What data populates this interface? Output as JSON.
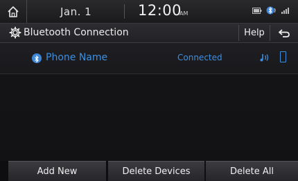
{
  "status_bar": {
    "date": "Jan. 1",
    "time": "12:00",
    "ampm": "AM",
    "icons": [
      "home-icon",
      "battery-icon",
      "bluetooth-status-icon",
      "signal-icon"
    ]
  },
  "title_bar": {
    "title": "Bluetooth Connection",
    "help_label": "Help",
    "icons": [
      "gear-icon",
      "back-icon"
    ]
  },
  "devices": [
    {
      "name": "Phone Name",
      "status": "Connected",
      "icons": [
        "bluetooth-icon",
        "audio-streaming-icon",
        "phone-icon"
      ]
    }
  ],
  "bottom_buttons": {
    "add_new": "Add New",
    "delete_devices": "Delete Devices",
    "delete_all": "Delete All"
  },
  "colors": {
    "accent": "#3d8fe0",
    "text": "#ececec",
    "background": "#141416"
  }
}
